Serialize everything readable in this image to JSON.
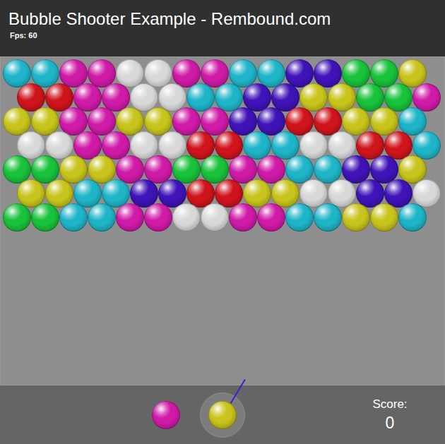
{
  "window": {
    "title": "Bubble Shooter Example - Rembound.com",
    "fps": "Fps: 60"
  },
  "grid": {
    "rows": [
      {
        "offset": false,
        "bubbles": [
          "#1fb5c9",
          "#1fb5c9",
          "#d01aa8",
          "#d01aa8",
          "#d8d8d8",
          "#d8d8d8",
          "#d01aa8",
          "#d01aa8",
          "#1fb5c9",
          "#1fb5c9",
          "#3f13b8",
          "#3f13b8",
          "#18c23a",
          "#18c23a",
          "#c8c41c"
        ]
      },
      {
        "offset": true,
        "bubbles": [
          "#d0141c",
          "#d0141c",
          "#d01aa8",
          "#d01aa8",
          "#d8d8d8",
          "#d8d8d8",
          "#1fb5c9",
          "#1fb5c9",
          "#3f13b8",
          "#3f13b8",
          "#c8c41c",
          "#c8c41c",
          "#18c23a",
          "#18c23a",
          "#d01aa8"
        ]
      },
      {
        "offset": false,
        "bubbles": [
          "#c8c41c",
          "#c8c41c",
          "#d01aa8",
          "#d01aa8",
          "#c8c41c",
          "#c8c41c",
          "#d01aa8",
          "#d01aa8",
          "#3f13b8",
          "#3f13b8",
          "#d0141c",
          "#d0141c",
          "#c8c41c",
          "#c8c41c",
          "#1fb5c9"
        ]
      },
      {
        "offset": true,
        "bubbles": [
          "#d8d8d8",
          "#d8d8d8",
          "#d01aa8",
          "#d01aa8",
          "#d8d8d8",
          "#d8d8d8",
          "#d0141c",
          "#d0141c",
          "#1fb5c9",
          "#1fb5c9",
          "#d8d8d8",
          "#d8d8d8",
          "#d0141c",
          "#d0141c",
          "#1fb5c9"
        ]
      },
      {
        "offset": false,
        "bubbles": [
          "#18c23a",
          "#18c23a",
          "#c8c41c",
          "#c8c41c",
          "#d01aa8",
          "#d01aa8",
          "#18c23a",
          "#18c23a",
          "#d01aa8",
          "#d01aa8",
          "#1fb5c9",
          "#1fb5c9",
          "#3f13b8",
          "#3f13b8",
          "#c8c41c"
        ]
      },
      {
        "offset": true,
        "bubbles": [
          "#c8c41c",
          "#c8c41c",
          "#1fb5c9",
          "#1fb5c9",
          "#3f13b8",
          "#3f13b8",
          "#d0141c",
          "#d0141c",
          "#c8c41c",
          "#c8c41c",
          "#d8d8d8",
          "#d8d8d8",
          "#3f13b8",
          "#3f13b8",
          "#d8d8d8"
        ]
      },
      {
        "offset": false,
        "bubbles": [
          "#18c23a",
          "#18c23a",
          "#1fb5c9",
          "#1fb5c9",
          "#d01aa8",
          "#d01aa8",
          "#d8d8d8",
          "#d8d8d8",
          "#d01aa8",
          "#d01aa8",
          "#1fb5c9",
          "#1fb5c9",
          "#c8c41c",
          "#c8c41c",
          "#1fb5c9"
        ]
      }
    ]
  },
  "player": {
    "next_color": "#d01aa8",
    "current_color": "#c8c41c",
    "aim_angle": 59
  },
  "score": {
    "label": "Score:",
    "value": "0"
  }
}
